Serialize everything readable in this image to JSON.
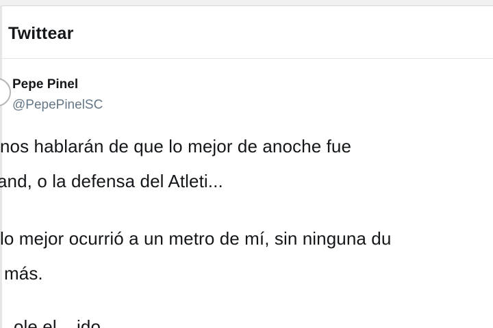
{
  "header": {
    "title": "Twittear"
  },
  "author": {
    "name": "Pepe Pinel",
    "handle": "@PepePinelSC"
  },
  "tweet": {
    "lines": [
      "nos hablarán de que lo mejor de anoche fue",
      "and, o la defensa del Atleti...",
      "lo mejor ocurrió a un metro de mí, sin ninguna du",
      "más.",
      "...ole el ...ido..."
    ]
  }
}
